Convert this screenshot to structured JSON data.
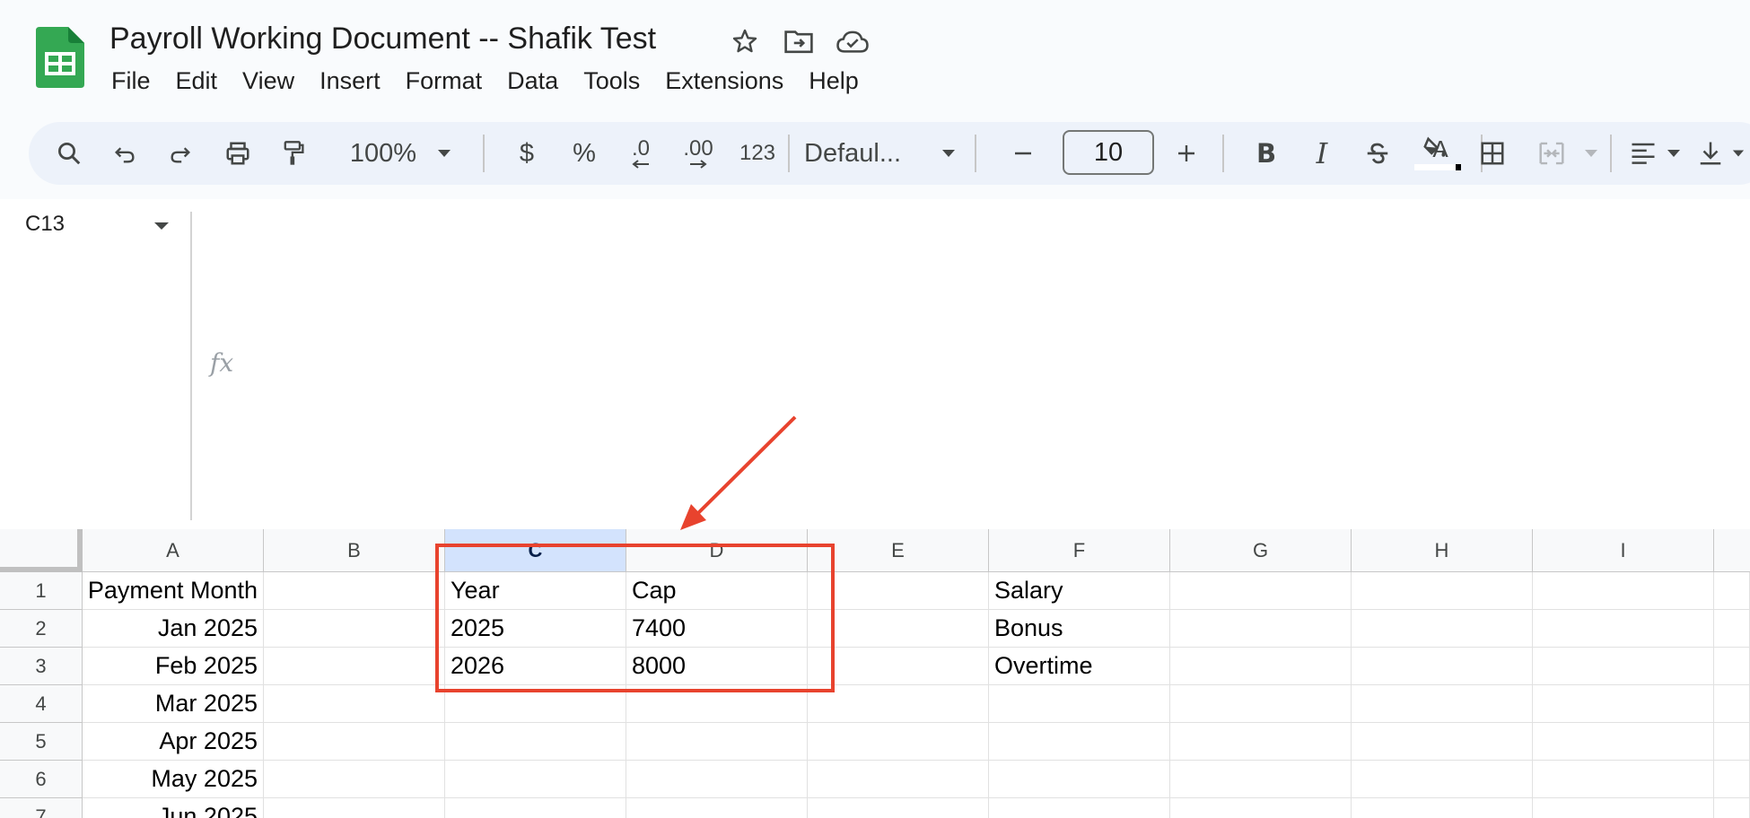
{
  "app": {
    "title": "Payroll Working Document -- Shafik Test",
    "title_icons": [
      "star-icon",
      "move-folder-icon",
      "cloud-saved-icon"
    ]
  },
  "menu": [
    "File",
    "Edit",
    "View",
    "Insert",
    "Format",
    "Data",
    "Tools",
    "Extensions",
    "Help"
  ],
  "toolbar": {
    "zoom": "100%",
    "currency": "$",
    "percent": "%",
    "decrease_decimal": ".0",
    "increase_decimal": ".00",
    "number_format": "123",
    "font": "Defaul...",
    "font_size": "10",
    "bold": "B",
    "italic": "I",
    "text_color": "A",
    "text_color_value": "#000000"
  },
  "formula_bar": {
    "cell_ref": "C13",
    "fx_label": "fx",
    "content": ""
  },
  "sheet": {
    "columns": [
      "A",
      "B",
      "C",
      "D",
      "E",
      "F",
      "G",
      "H",
      "I"
    ],
    "selected_column": "C",
    "rows": [
      {
        "num": "1",
        "A": "Payment Month",
        "B": "",
        "C": "Year",
        "D": "Cap",
        "E": "",
        "F": "Salary"
      },
      {
        "num": "2",
        "A": "Jan 2025",
        "B": "",
        "C": "2025",
        "D": "7400",
        "E": "",
        "F": "Bonus"
      },
      {
        "num": "3",
        "A": "Feb 2025",
        "B": "",
        "C": "2026",
        "D": "8000",
        "E": "",
        "F": "Overtime"
      },
      {
        "num": "4",
        "A": "Mar 2025",
        "B": "",
        "C": "",
        "D": "",
        "E": "",
        "F": ""
      },
      {
        "num": "5",
        "A": "Apr 2025",
        "B": "",
        "C": "",
        "D": "",
        "E": "",
        "F": ""
      },
      {
        "num": "6",
        "A": "May 2025",
        "B": "",
        "C": "",
        "D": "",
        "E": "",
        "F": ""
      },
      {
        "num": "7",
        "A": "Jun 2025",
        "B": "",
        "C": "",
        "D": "",
        "E": "",
        "F": ""
      }
    ]
  },
  "annotation": {
    "color": "#e8432e",
    "target": "C1:D3"
  }
}
